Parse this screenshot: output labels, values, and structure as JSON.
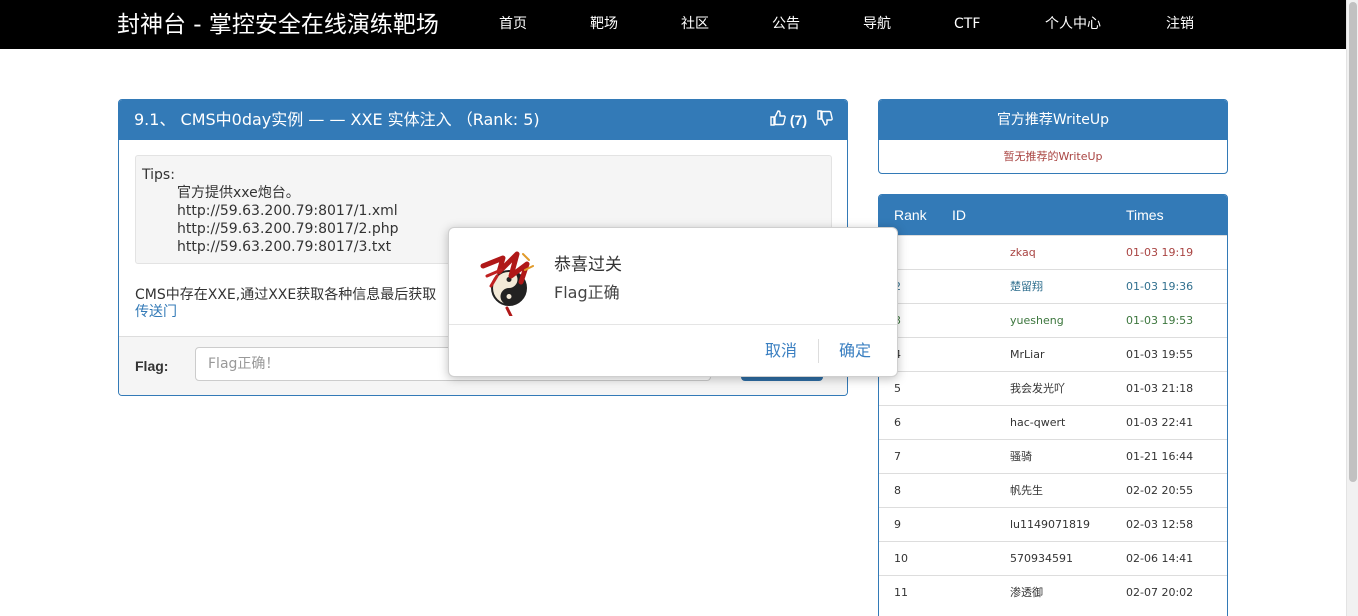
{
  "navbar": {
    "brand": "封神台 - 掌控安全在线演练靶场",
    "items": [
      {
        "label": "首页"
      },
      {
        "label": "靶场"
      },
      {
        "label": "社区"
      },
      {
        "label": "公告"
      },
      {
        "label": "导航"
      },
      {
        "label": "CTF"
      },
      {
        "label": "个人中心"
      },
      {
        "label": "注销"
      }
    ]
  },
  "challenge": {
    "title": "9.1、 CMS中0day实例 — — XXE 实体注入 （Rank: 5)",
    "likes": "(7)",
    "tips": {
      "label": "Tips:",
      "lines": [
        "官方提供xxe炮台。",
        "http://59.63.200.79:8017/1.xml",
        "http://59.63.200.79:8017/2.php",
        "http://59.63.200.79:8017/3.txt"
      ]
    },
    "description": "CMS中存在XXE,通过XXE获取各种信息最后获取",
    "portal_link": "传送门",
    "flag_label": "Flag:",
    "flag_value": "Flag正确！"
  },
  "writeup": {
    "title": "官方推荐WriteUp",
    "empty_text": "暂无推荐的WriteUp"
  },
  "rank": {
    "headers": {
      "rank": "Rank",
      "id": "ID",
      "times": "Times"
    },
    "rows": [
      {
        "rank": "",
        "id": "zkaq",
        "time": "01-03 19:19",
        "color": "#a94442"
      },
      {
        "rank": "2",
        "id": "楚留翔",
        "time": "01-03 19:36",
        "color": "#31708f"
      },
      {
        "rank": "3",
        "id": "yuesheng",
        "time": "01-03 19:53",
        "color": "#3c763d"
      },
      {
        "rank": "4",
        "id": "MrLiar",
        "time": "01-03 19:55",
        "color": "#333333"
      },
      {
        "rank": "5",
        "id": "我会发光吖",
        "time": "01-03 21:18",
        "color": "#333333"
      },
      {
        "rank": "6",
        "id": "hac-qwert",
        "time": "01-03 22:41",
        "color": "#333333"
      },
      {
        "rank": "7",
        "id": "骚骑",
        "time": "01-21 16:44",
        "color": "#333333"
      },
      {
        "rank": "8",
        "id": "帆先生",
        "time": "02-02 20:55",
        "color": "#333333"
      },
      {
        "rank": "9",
        "id": "lu1149071819",
        "time": "02-03 12:58",
        "color": "#333333"
      },
      {
        "rank": "10",
        "id": "570934591",
        "time": "02-06 14:41",
        "color": "#333333"
      },
      {
        "rank": "11",
        "id": "渗透御",
        "time": "02-07 20:02",
        "color": "#333333"
      }
    ]
  },
  "modal": {
    "title": "恭喜过关",
    "message": "Flag正确",
    "cancel_label": "取消",
    "confirm_label": "确定",
    "logo_icon": "fengshen-logo-icon"
  },
  "colors": {
    "primary": "#337ab7",
    "navbar": "#000000",
    "link": "#3a7fc1"
  }
}
